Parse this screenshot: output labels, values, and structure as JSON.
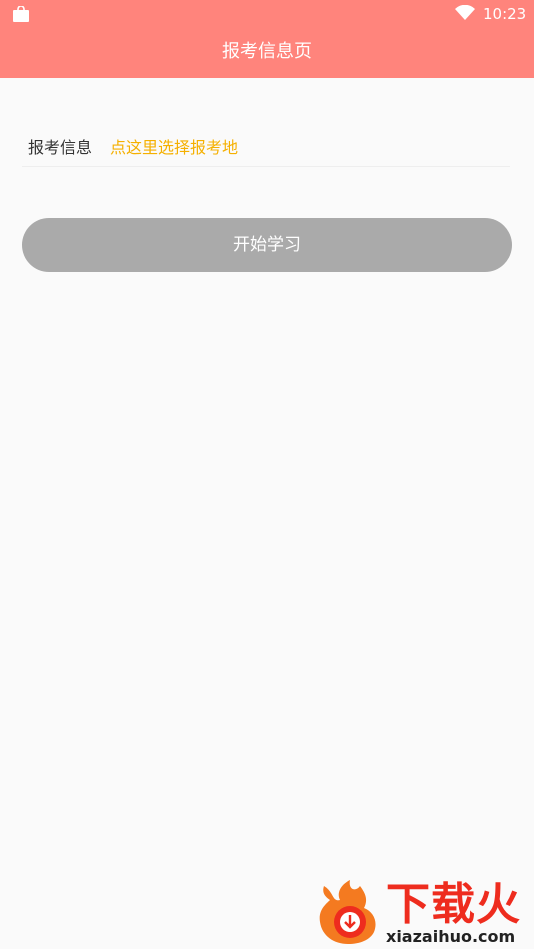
{
  "status_bar": {
    "time": "10:23",
    "left_icon": "shopping-bag-icon",
    "right_icon": "wifi-icon"
  },
  "header": {
    "title": "报考信息页",
    "background_color": "#ff847c"
  },
  "form": {
    "info_label": "报考信息",
    "info_placeholder": "点这里选择报考地",
    "placeholder_color": "#f5b000"
  },
  "actions": {
    "start_label": "开始学习",
    "button_color": "#aaaaaa"
  },
  "watermark": {
    "brand_cn": "下载火",
    "brand_en": "xiazaihuo.com",
    "brand_color": "#ee2c1e"
  }
}
